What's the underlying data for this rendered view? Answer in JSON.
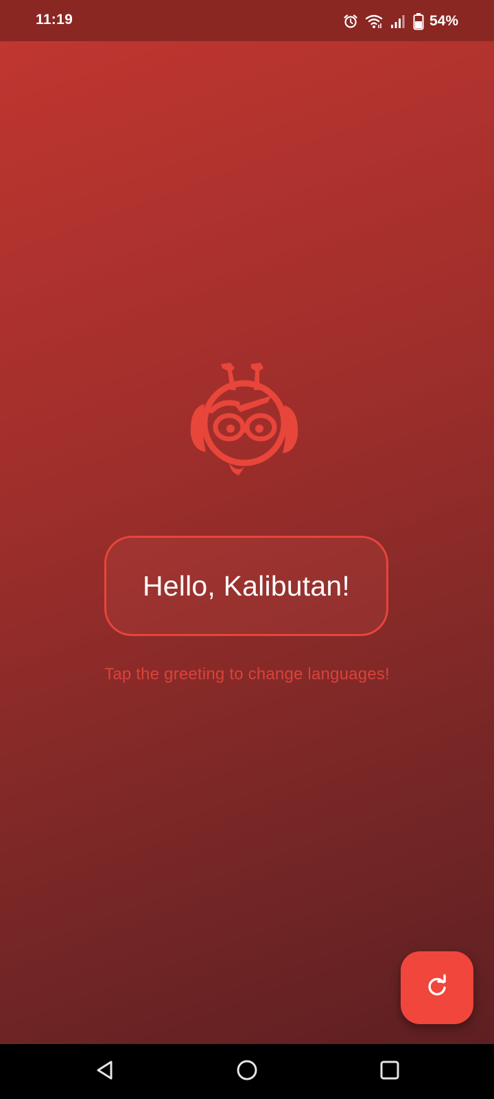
{
  "status_bar": {
    "time": "11:19",
    "battery_percent": "54%",
    "icons": [
      "alarm-icon",
      "wifi-icon",
      "signal-icon",
      "battery-icon"
    ]
  },
  "main": {
    "greeting": "Hello, Kalibutan!",
    "hint": "Tap the greeting to change languages!",
    "refresh_icon": "refresh-icon",
    "mascot_icon": "robot-mascot-icon"
  },
  "nav_bar": {
    "icons": [
      "back-icon",
      "home-icon",
      "recents-icon"
    ]
  },
  "colors": {
    "accent": "#f0463b",
    "status_bar": "#8a2723",
    "background_top": "#c03630",
    "background_bottom": "#5e1f22",
    "hint_text": "#d9433b"
  }
}
